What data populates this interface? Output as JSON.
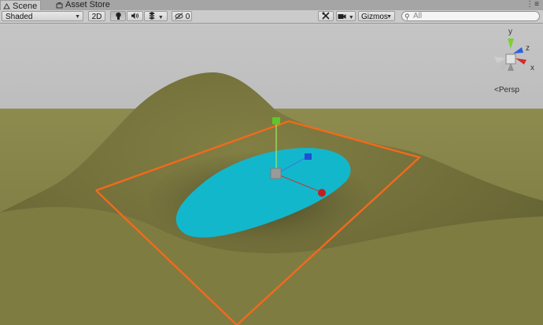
{
  "tabs": [
    {
      "label": "Scene",
      "icon": "scene-icon",
      "active": true
    },
    {
      "label": "Asset Store",
      "icon": "asset-store-icon",
      "active": false
    }
  ],
  "window_menu": "⋮≡",
  "toolbar": {
    "draw_mode": "Shaded",
    "mode_2d": "2D",
    "hidden_count": "0",
    "gizmos": "Gizmos",
    "search_placeholder": "All"
  },
  "gizmo": {
    "projection": "Persp",
    "axes": {
      "y": "y",
      "z": "z",
      "x": "x"
    },
    "colors": {
      "x": "#d42b2b",
      "y": "#7ad12a",
      "z": "#2f5fe0"
    }
  },
  "scene": {
    "sky_color": "#b9b9b9",
    "terrain_color": "#7c7a42",
    "water_color": "#12b7cc",
    "selection_outline_color": "#f26a1b"
  }
}
